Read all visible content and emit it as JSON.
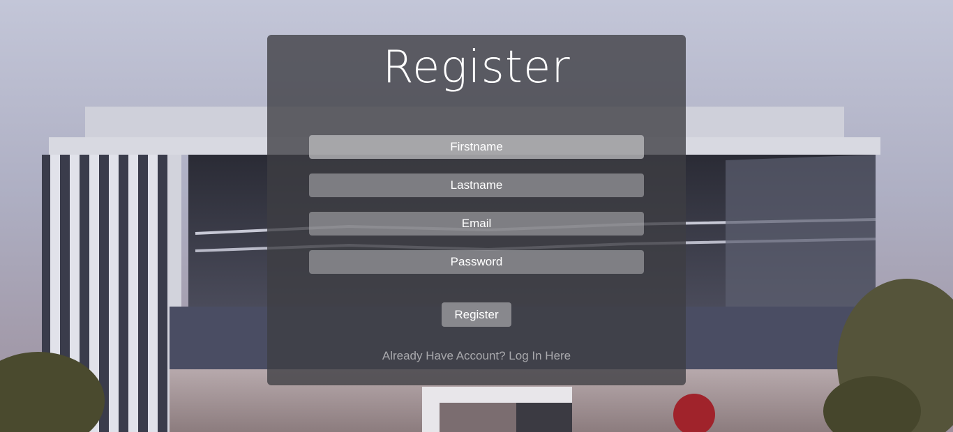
{
  "form": {
    "title": "Register",
    "firstname_placeholder": "Firstname",
    "lastname_placeholder": "Lastname",
    "email_placeholder": "Email",
    "password_placeholder": "Password",
    "submit_label": "Register",
    "login_link": "Already Have Account? Log In Here"
  },
  "colors": {
    "panel": "#3e3e42",
    "text": "#ffffff",
    "link": "#a9a9ad"
  }
}
